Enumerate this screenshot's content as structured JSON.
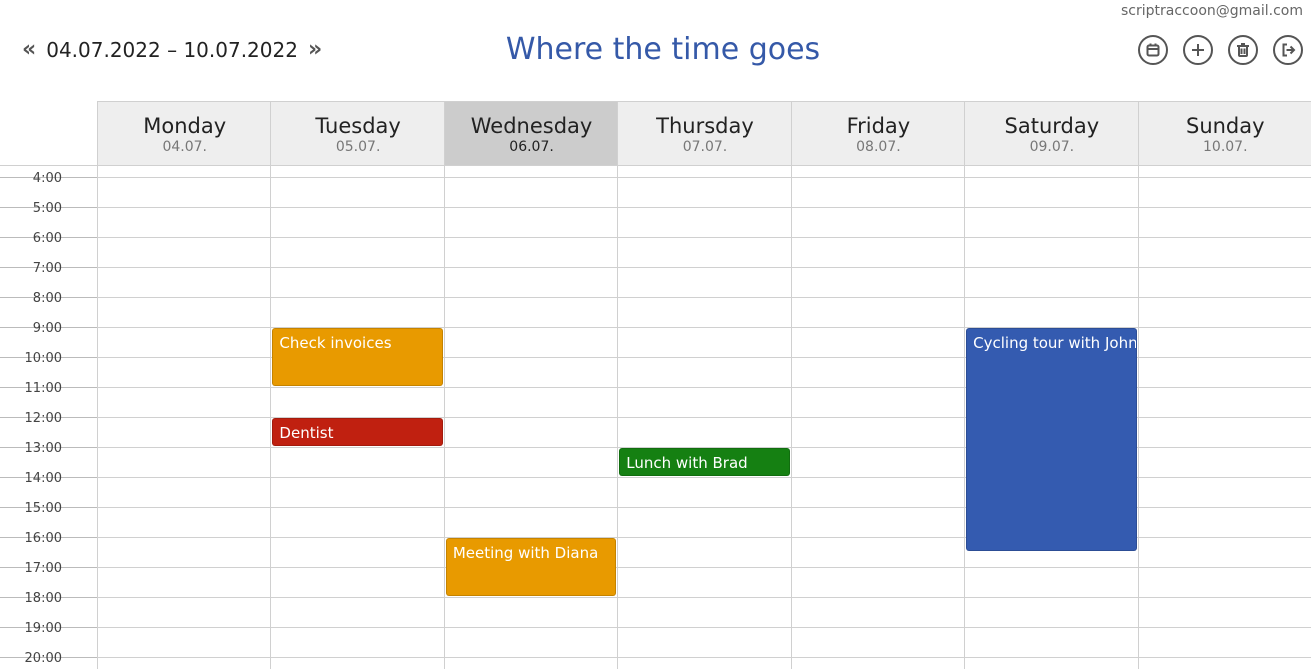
{
  "header": {
    "user_email": "scriptraccoon@gmail.com",
    "date_range": "04.07.2022 – 10.07.2022",
    "prev_icon": "«",
    "next_icon": "»",
    "title": "Where the time goes",
    "actions": [
      {
        "name": "calendar-today-icon"
      },
      {
        "name": "add-event-icon"
      },
      {
        "name": "delete-icon"
      },
      {
        "name": "logout-icon"
      }
    ]
  },
  "days": [
    {
      "name": "Monday",
      "date": "04.07.",
      "today": false
    },
    {
      "name": "Tuesday",
      "date": "05.07.",
      "today": false
    },
    {
      "name": "Wednesday",
      "date": "06.07.",
      "today": true
    },
    {
      "name": "Thursday",
      "date": "07.07.",
      "today": false
    },
    {
      "name": "Friday",
      "date": "08.07.",
      "today": false
    },
    {
      "name": "Saturday",
      "date": "09.07.",
      "today": false
    },
    {
      "name": "Sunday",
      "date": "10.07.",
      "today": false
    }
  ],
  "hours": [
    "4:00",
    "5:00",
    "6:00",
    "7:00",
    "8:00",
    "9:00",
    "10:00",
    "11:00",
    "12:00",
    "13:00",
    "14:00",
    "15:00",
    "16:00",
    "17:00",
    "18:00",
    "19:00",
    "20:00"
  ],
  "events": [
    {
      "title": "Check invoices",
      "day": 1,
      "start": 9,
      "end": 11,
      "color": "#e89a00"
    },
    {
      "title": "Dentist",
      "day": 1,
      "start": 12,
      "end": 13,
      "color": "#c02010"
    },
    {
      "title": "Lunch with Brad",
      "day": 3,
      "start": 13,
      "end": 14,
      "color": "#158012"
    },
    {
      "title": "Meeting with Diana",
      "day": 2,
      "start": 16,
      "end": 18,
      "color": "#e89a00"
    },
    {
      "title": "Cycling tour with John",
      "day": 5,
      "start": 9,
      "end": 16.5,
      "color": "#345bb0"
    }
  ]
}
